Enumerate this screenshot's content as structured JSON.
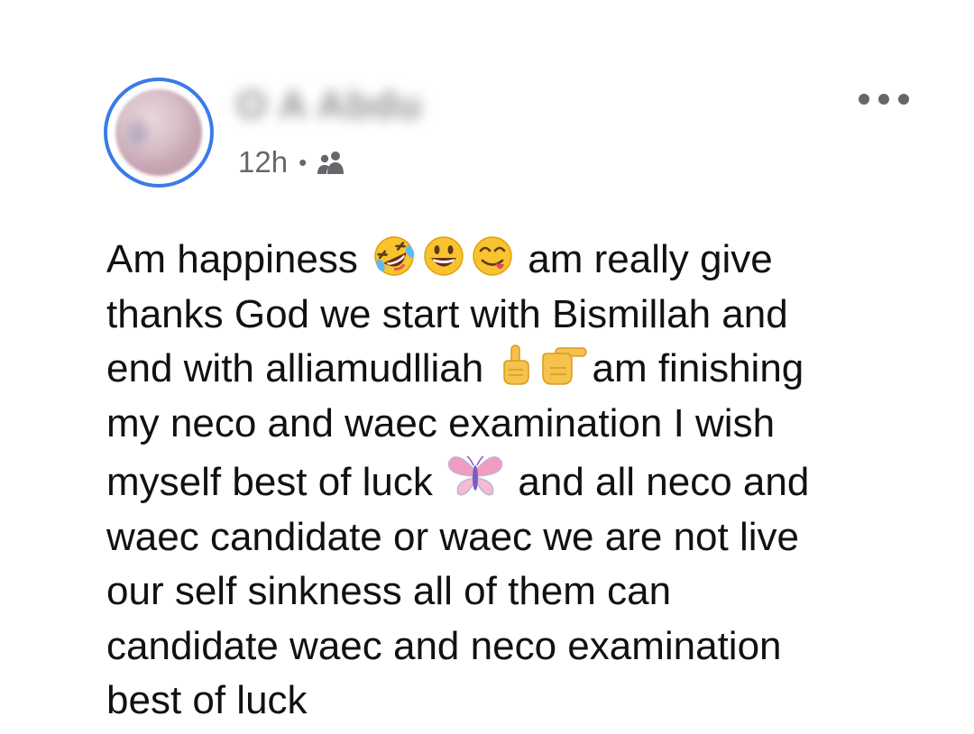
{
  "post": {
    "author": {
      "name": "O A Abdu",
      "avatar_icon": "profile-photo"
    },
    "timestamp": "12h",
    "separator": "•",
    "audience_icon": "friends-icon",
    "menu_icon": "more-options-icon",
    "body": {
      "line1_start": "Am happiness",
      "line1_end": "am really give",
      "line2": "thanks God we start with Bismillah and",
      "line3_start": "end with alliamudlliah",
      "line3_end": "am finishing",
      "line4": "my neco and waec examination I wish",
      "line5_start": "myself best of luck",
      "line5_end": "and all neco and",
      "line6": "waec candidate or waec we are not live",
      "line7": "our self sinkness all of them can",
      "line8": "candidate waec and neco examination",
      "line9": "best of luck"
    },
    "emojis": [
      "rolling-laughing-emoji",
      "grinning-emoji",
      "savoring-food-emoji",
      "index-up-emoji",
      "backhand-point-right-emoji",
      "butterfly-emoji"
    ],
    "colors": {
      "accent": "#3b7be8",
      "meta_text": "#65676b",
      "body_text": "#111111"
    }
  }
}
